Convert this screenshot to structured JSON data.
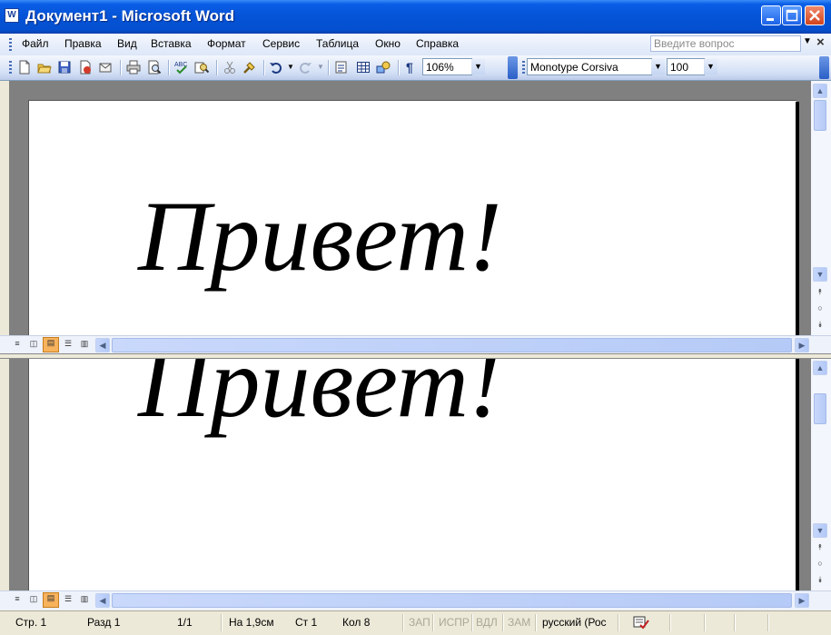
{
  "window": {
    "title": "Документ1 - Microsoft Word"
  },
  "menu": {
    "items": [
      "Файл",
      "Правка",
      "Вид",
      "Вставка",
      "Формат",
      "Сервис",
      "Таблица",
      "Окно",
      "Справка"
    ],
    "ask_placeholder": "Введите вопрос"
  },
  "toolbar": {
    "zoom": "106%",
    "font_name": "Monotype Corsiva",
    "font_size": "100",
    "pilcrow": "¶"
  },
  "document": {
    "top_pane_text": "Привет!",
    "bottom_pane_text": "Привет!"
  },
  "status": {
    "page": "Стр. 1",
    "section": "Разд 1",
    "pages": "1/1",
    "at": "На 1,9см",
    "line": "Ст 1",
    "col": "Кол 8",
    "rec": "ЗАП",
    "trk": "ИСПР",
    "ext": "ВДЛ",
    "ovr": "ЗАМ",
    "language": "русский (Рос"
  },
  "colors": {
    "titlebar": "#0553d6",
    "close_button": "#d2431c",
    "active_view": "#f7b25c"
  }
}
